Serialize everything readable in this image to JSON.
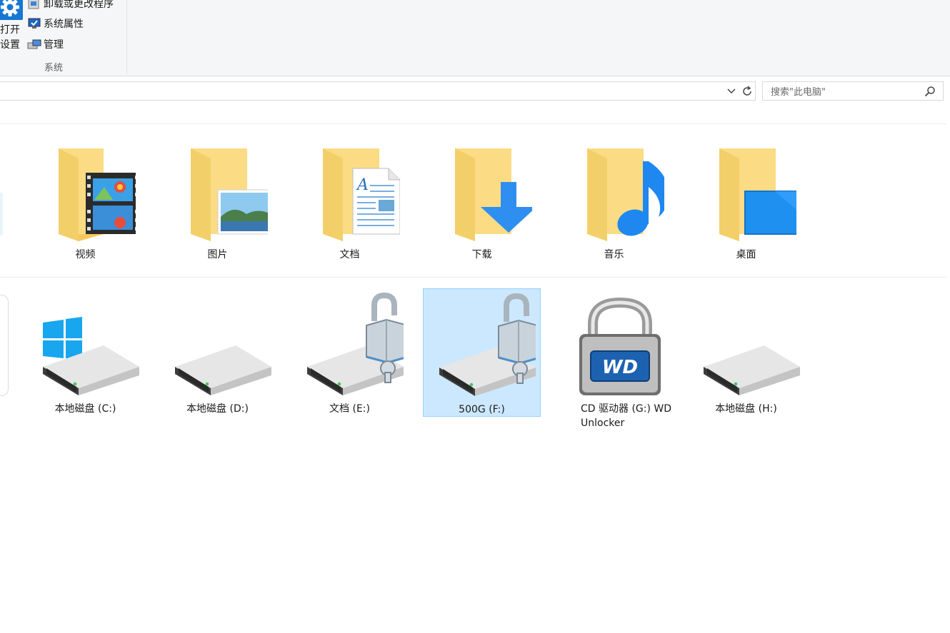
{
  "ribbon": {
    "open_settings_line1": "打开",
    "open_settings_line2": "设置",
    "items": [
      {
        "label": "卸载或更改程序",
        "icon": "uninstall-program-icon"
      },
      {
        "label": "系统属性",
        "icon": "system-properties-icon"
      },
      {
        "label": "管理",
        "icon": "manage-icon"
      }
    ],
    "group_label": "系统"
  },
  "search": {
    "placeholder": "搜索\"此电脑\""
  },
  "folders": [
    {
      "label": "视频",
      "icon": "videos-folder-icon"
    },
    {
      "label": "图片",
      "icon": "pictures-folder-icon"
    },
    {
      "label": "文档",
      "icon": "documents-folder-icon"
    },
    {
      "label": "下载",
      "icon": "downloads-folder-icon"
    },
    {
      "label": "音乐",
      "icon": "music-folder-icon"
    },
    {
      "label": "桌面",
      "icon": "desktop-folder-icon"
    }
  ],
  "drives": [
    {
      "label": "本地磁盘 (C:)",
      "icon": "windows-drive-icon",
      "selected": false
    },
    {
      "label": "本地磁盘 (D:)",
      "icon": "hard-drive-icon",
      "selected": false
    },
    {
      "label": "文档 (E:)",
      "icon": "locked-drive-icon",
      "selected": false
    },
    {
      "label": "500G (F:)",
      "icon": "locked-drive-icon",
      "selected": true
    },
    {
      "label": "CD 驱动器 (G:) WD Unlocker",
      "icon": "wd-unlocker-icon",
      "selected": false
    },
    {
      "label": "本地磁盘 (H:)",
      "icon": "hard-drive-icon",
      "selected": false
    }
  ],
  "colors": {
    "selection_bg": "#cce8ff",
    "selection_border": "#99d1ff",
    "folder_yellow": "#f8d775",
    "accent_blue": "#1e90ff"
  }
}
